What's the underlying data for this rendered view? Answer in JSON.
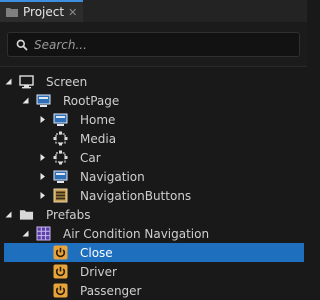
{
  "tab": {
    "title": "Project",
    "close_glyph": "✕"
  },
  "search": {
    "placeholder": "Search..."
  },
  "tree": [
    {
      "label": "Screen",
      "icon": "screen-icon",
      "arrow": "expanded"
    },
    {
      "label": "RootPage",
      "icon": "page-icon",
      "arrow": "expanded"
    },
    {
      "label": "Home",
      "icon": "page-icon",
      "arrow": "collapsed"
    },
    {
      "label": "Media",
      "icon": "component-icon",
      "arrow": "none"
    },
    {
      "label": "Car",
      "icon": "component-icon",
      "arrow": "collapsed"
    },
    {
      "label": "Navigation",
      "icon": "page-icon",
      "arrow": "collapsed"
    },
    {
      "label": "NavigationButtons",
      "icon": "list-icon",
      "arrow": "collapsed"
    },
    {
      "label": "Prefabs",
      "icon": "folder-icon",
      "arrow": "expanded"
    },
    {
      "label": "Air Condition Navigation",
      "icon": "grid-icon",
      "arrow": "expanded"
    },
    {
      "label": "Close",
      "icon": "power-button-icon",
      "arrow": "none",
      "selected": true
    },
    {
      "label": "Driver",
      "icon": "power-button-icon",
      "arrow": "none"
    },
    {
      "label": "Passenger",
      "icon": "power-button-icon",
      "arrow": "none"
    }
  ],
  "colors": {
    "selection": "#1f6fbf",
    "accent_tab": "#3d8ede",
    "prefab_orange": "#e8a33a"
  }
}
